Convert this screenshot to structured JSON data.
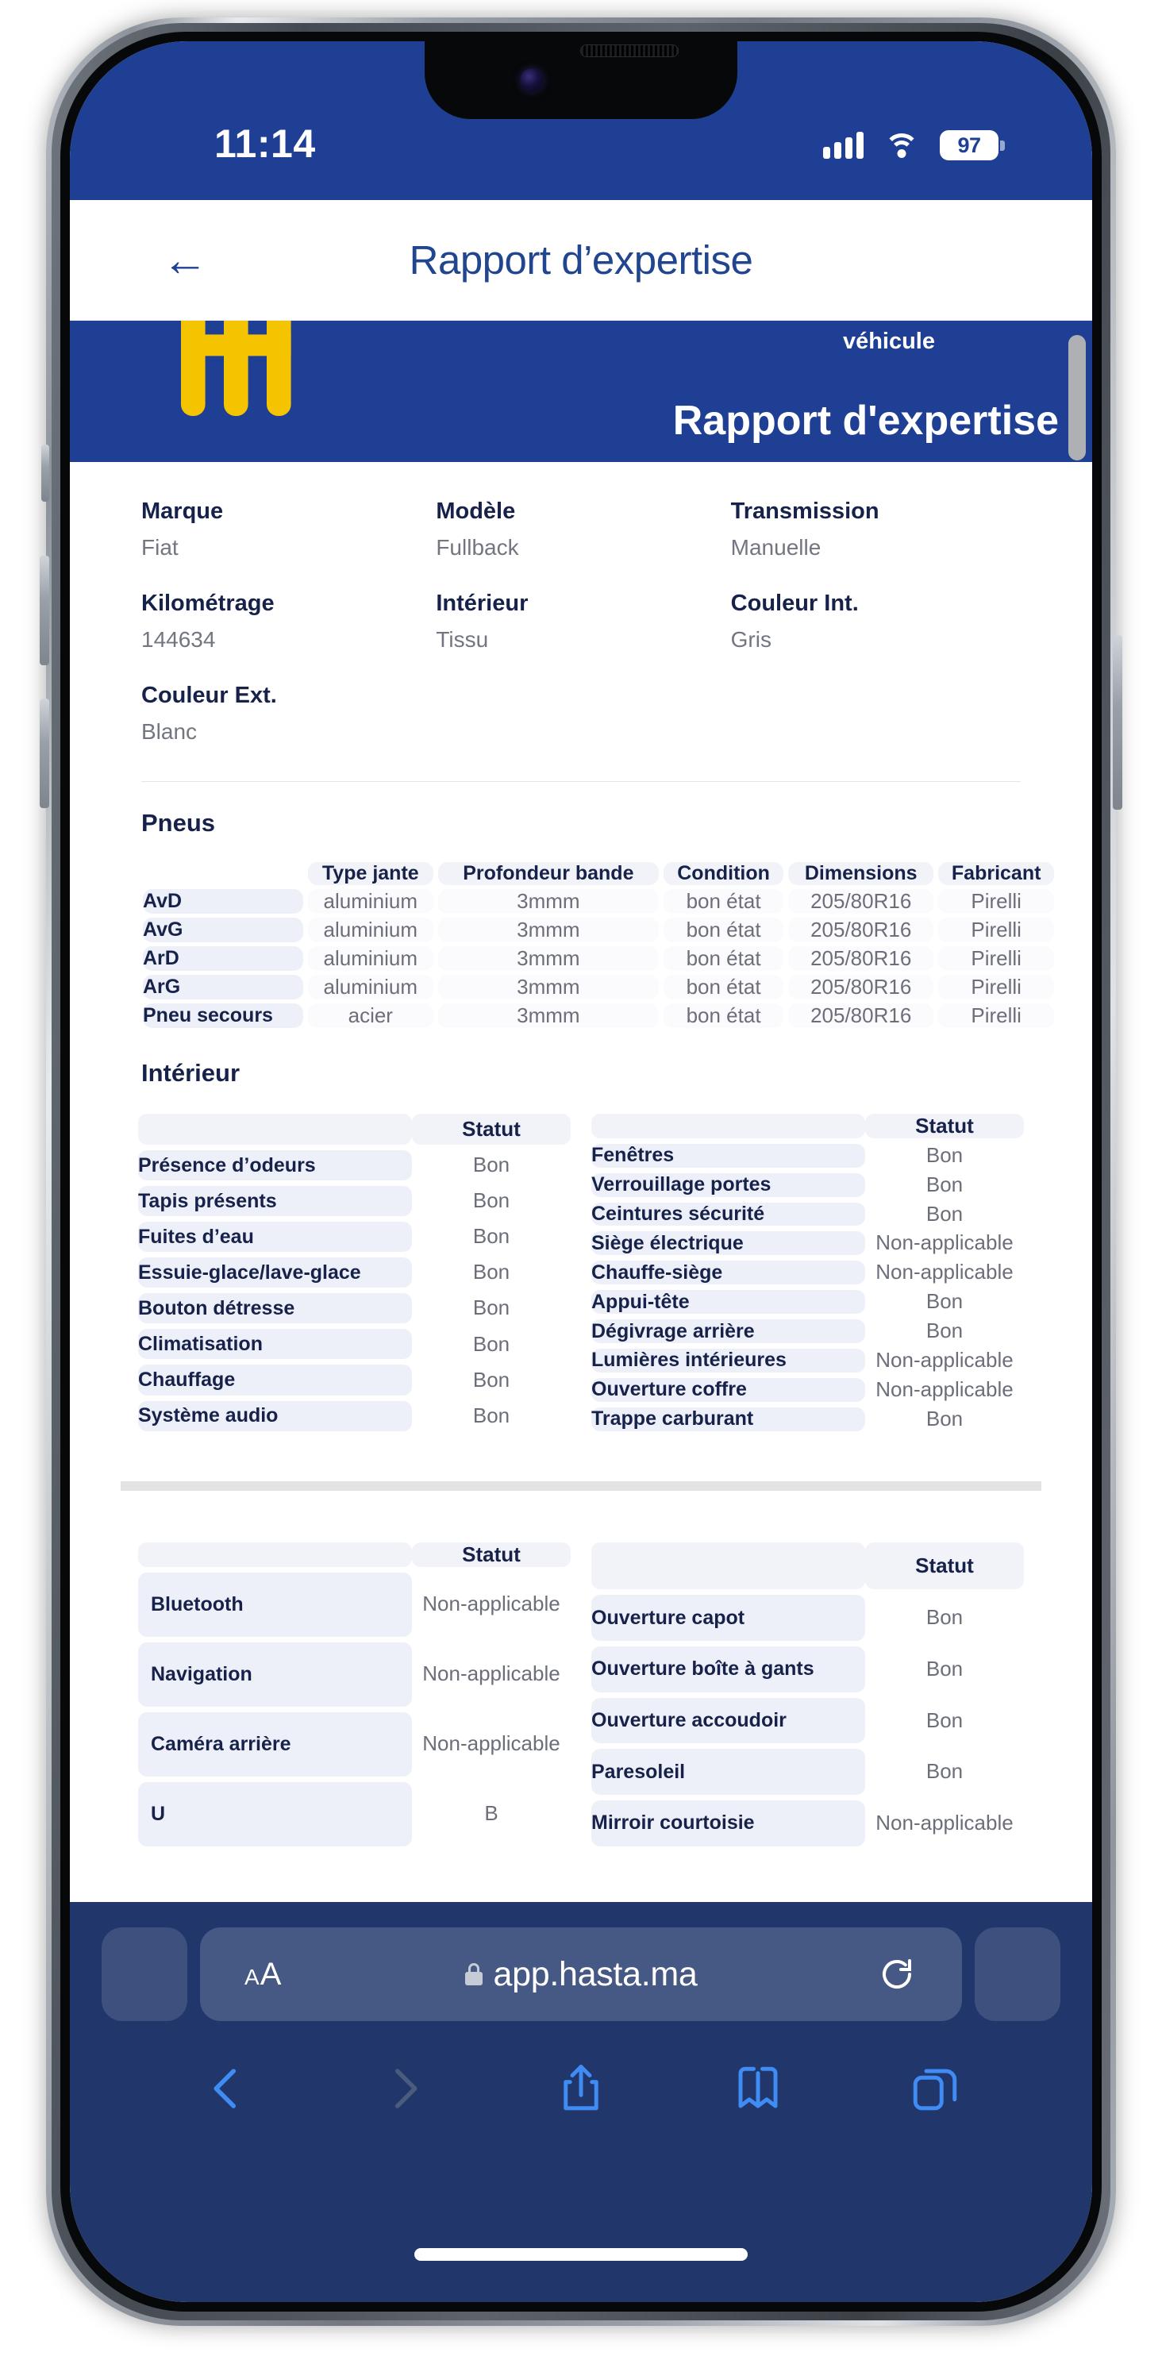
{
  "status_bar": {
    "time": "11:14",
    "battery_percent": "97"
  },
  "app_header": {
    "title": "Rapport d’expertise",
    "back_icon": "arrow-left-icon"
  },
  "document": {
    "banner": {
      "subtitle": "véhicule",
      "title": "Rapport d'expertise",
      "logo": "hasta-hh-logo"
    },
    "vehicle_info": [
      {
        "label": "Marque",
        "value": "Fiat"
      },
      {
        "label": "Modèle",
        "value": "Fullback"
      },
      {
        "label": "Transmission",
        "value": "Manuelle"
      },
      {
        "label": "Kilométrage",
        "value": "144634"
      },
      {
        "label": "Intérieur",
        "value": "Tissu"
      },
      {
        "label": "Couleur Int.",
        "value": "Gris"
      },
      {
        "label": "Couleur Ext.",
        "value": "Blanc"
      }
    ],
    "pneus": {
      "title": "Pneus",
      "columns": [
        "",
        "Type jante",
        "Profondeur bande",
        "Condition",
        "Dimensions",
        "Fabricant"
      ],
      "rows": [
        {
          "name": "AvD",
          "cells": [
            "aluminium",
            "3mmm",
            "bon état",
            "205/80R16",
            "Pirelli"
          ]
        },
        {
          "name": "AvG",
          "cells": [
            "aluminium",
            "3mmm",
            "bon état",
            "205/80R16",
            "Pirelli"
          ]
        },
        {
          "name": "ArD",
          "cells": [
            "aluminium",
            "3mmm",
            "bon état",
            "205/80R16",
            "Pirelli"
          ]
        },
        {
          "name": "ArG",
          "cells": [
            "aluminium",
            "3mmm",
            "bon état",
            "205/80R16",
            "Pirelli"
          ]
        },
        {
          "name": "Pneu secours",
          "cells": [
            "acier",
            "3mmm",
            "bon état",
            "205/80R16",
            "Pirelli"
          ]
        }
      ]
    },
    "interieur": {
      "title": "Intérieur",
      "status_header": "Statut",
      "left_rows": [
        {
          "name": "Présence d’odeurs",
          "status": "Bon"
        },
        {
          "name": "Tapis présents",
          "status": "Bon"
        },
        {
          "name": "Fuites d’eau",
          "status": "Bon"
        },
        {
          "name": "Essuie-glace/lave-glace",
          "status": "Bon"
        },
        {
          "name": "Bouton détresse",
          "status": "Bon"
        },
        {
          "name": "Climatisation",
          "status": "Bon"
        },
        {
          "name": "Chauffage",
          "status": "Bon"
        },
        {
          "name": "Système audio",
          "status": "Bon"
        }
      ],
      "right_rows": [
        {
          "name": "Fenêtres",
          "status": "Bon"
        },
        {
          "name": "Verrouillage portes",
          "status": "Bon"
        },
        {
          "name": "Ceintures sécurité",
          "status": "Bon"
        },
        {
          "name": "Siège électrique",
          "status": "Non-applicable"
        },
        {
          "name": "Chauffe-siège",
          "status": "Non-applicable"
        },
        {
          "name": "Appui-tête",
          "status": "Bon"
        },
        {
          "name": "Dégivrage arrière",
          "status": "Bon"
        },
        {
          "name": "Lumières intérieures",
          "status": "Non-applicable"
        },
        {
          "name": "Ouverture coffre",
          "status": "Non-applicable"
        },
        {
          "name": "Trappe carburant",
          "status": "Bon"
        }
      ]
    },
    "page2": {
      "status_header": "Statut",
      "left_rows": [
        {
          "name": "Bluetooth",
          "status": "Non-applicable"
        },
        {
          "name": "Navigation",
          "status": "Non-applicable"
        },
        {
          "name": "Caméra arrière",
          "status": "Non-applicable"
        },
        {
          "name": "U",
          "status": "B"
        }
      ],
      "right_rows": [
        {
          "name": "Ouverture capot",
          "status": "Bon"
        },
        {
          "name": "Ouverture boîte à gants",
          "status": "Bon"
        },
        {
          "name": "Ouverture accoudoir",
          "status": "Bon"
        },
        {
          "name": "Paresoleil",
          "status": "Bon"
        },
        {
          "name": "Mirroir courtoisie",
          "status": "Non-applicable"
        }
      ]
    }
  },
  "safari": {
    "text_size_label_small": "A",
    "text_size_label_large": "A",
    "url": "app.hasta.ma",
    "lock_icon": "lock-icon",
    "reload_icon": "reload-icon",
    "toolbar": {
      "back_icon": "chevron-left-icon",
      "forward_icon": "chevron-right-icon",
      "share_icon": "share-icon",
      "bookmarks_icon": "book-icon",
      "tabs_icon": "tabs-icon"
    }
  },
  "colors": {
    "brand_blue": "#1e3f93",
    "accent_yellow": "#f5c400",
    "safari_chrome": "#21376b"
  }
}
